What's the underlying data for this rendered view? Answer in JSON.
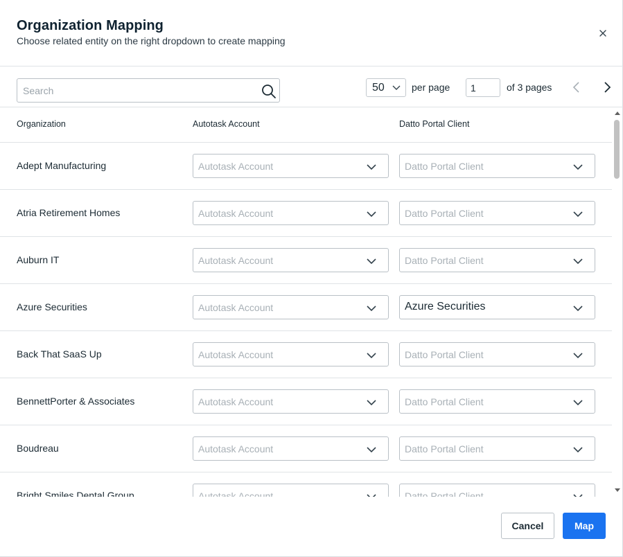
{
  "dialog": {
    "title": "Organization Mapping",
    "subtitle": "Choose related entity on the right dropdown to create mapping"
  },
  "toolbar": {
    "search_placeholder": "Search",
    "per_page_value": "50",
    "per_page_label": "per page",
    "current_page": "1",
    "pages_label": "of 3 pages"
  },
  "table": {
    "columns": [
      "Organization",
      "Autotask Account",
      "Datto Portal Client"
    ],
    "account_placeholder": "Autotask Account",
    "client_placeholder": "Datto Portal Client",
    "rows": [
      {
        "organization": "Adept Manufacturing",
        "autotask_account": "Autotask Account",
        "datto_client": "Datto Portal Client",
        "client_selected": false
      },
      {
        "organization": "Atria Retirement Homes",
        "autotask_account": "Autotask Account",
        "datto_client": "Datto Portal Client",
        "client_selected": false
      },
      {
        "organization": "Auburn IT",
        "autotask_account": "Autotask Account",
        "datto_client": "Datto Portal Client",
        "client_selected": false
      },
      {
        "organization": "Azure Securities",
        "autotask_account": "Autotask Account",
        "datto_client": "Azure Securities",
        "client_selected": true
      },
      {
        "organization": "Back That SaaS Up",
        "autotask_account": "Autotask Account",
        "datto_client": "Datto Portal Client",
        "client_selected": false
      },
      {
        "organization": "BennettPorter & Associates",
        "autotask_account": "Autotask Account",
        "datto_client": "Datto Portal Client",
        "client_selected": false
      },
      {
        "organization": "Boudreau",
        "autotask_account": "Autotask Account",
        "datto_client": "Datto Portal Client",
        "client_selected": false
      },
      {
        "organization": "Bright Smiles Dental Group",
        "autotask_account": "Autotask Account",
        "datto_client": "Datto Portal Client",
        "client_selected": false
      }
    ]
  },
  "footer": {
    "cancel_label": "Cancel",
    "map_label": "Map"
  },
  "colors": {
    "primary": "#1a73f0",
    "border": "#b9c0c6",
    "placeholder_text": "#a8b0b6"
  },
  "icons": {
    "close": "close-icon",
    "search": "search-icon",
    "dropdown": "chevron-down-icon",
    "prev": "chevron-left-icon",
    "next": "chevron-right-icon"
  }
}
